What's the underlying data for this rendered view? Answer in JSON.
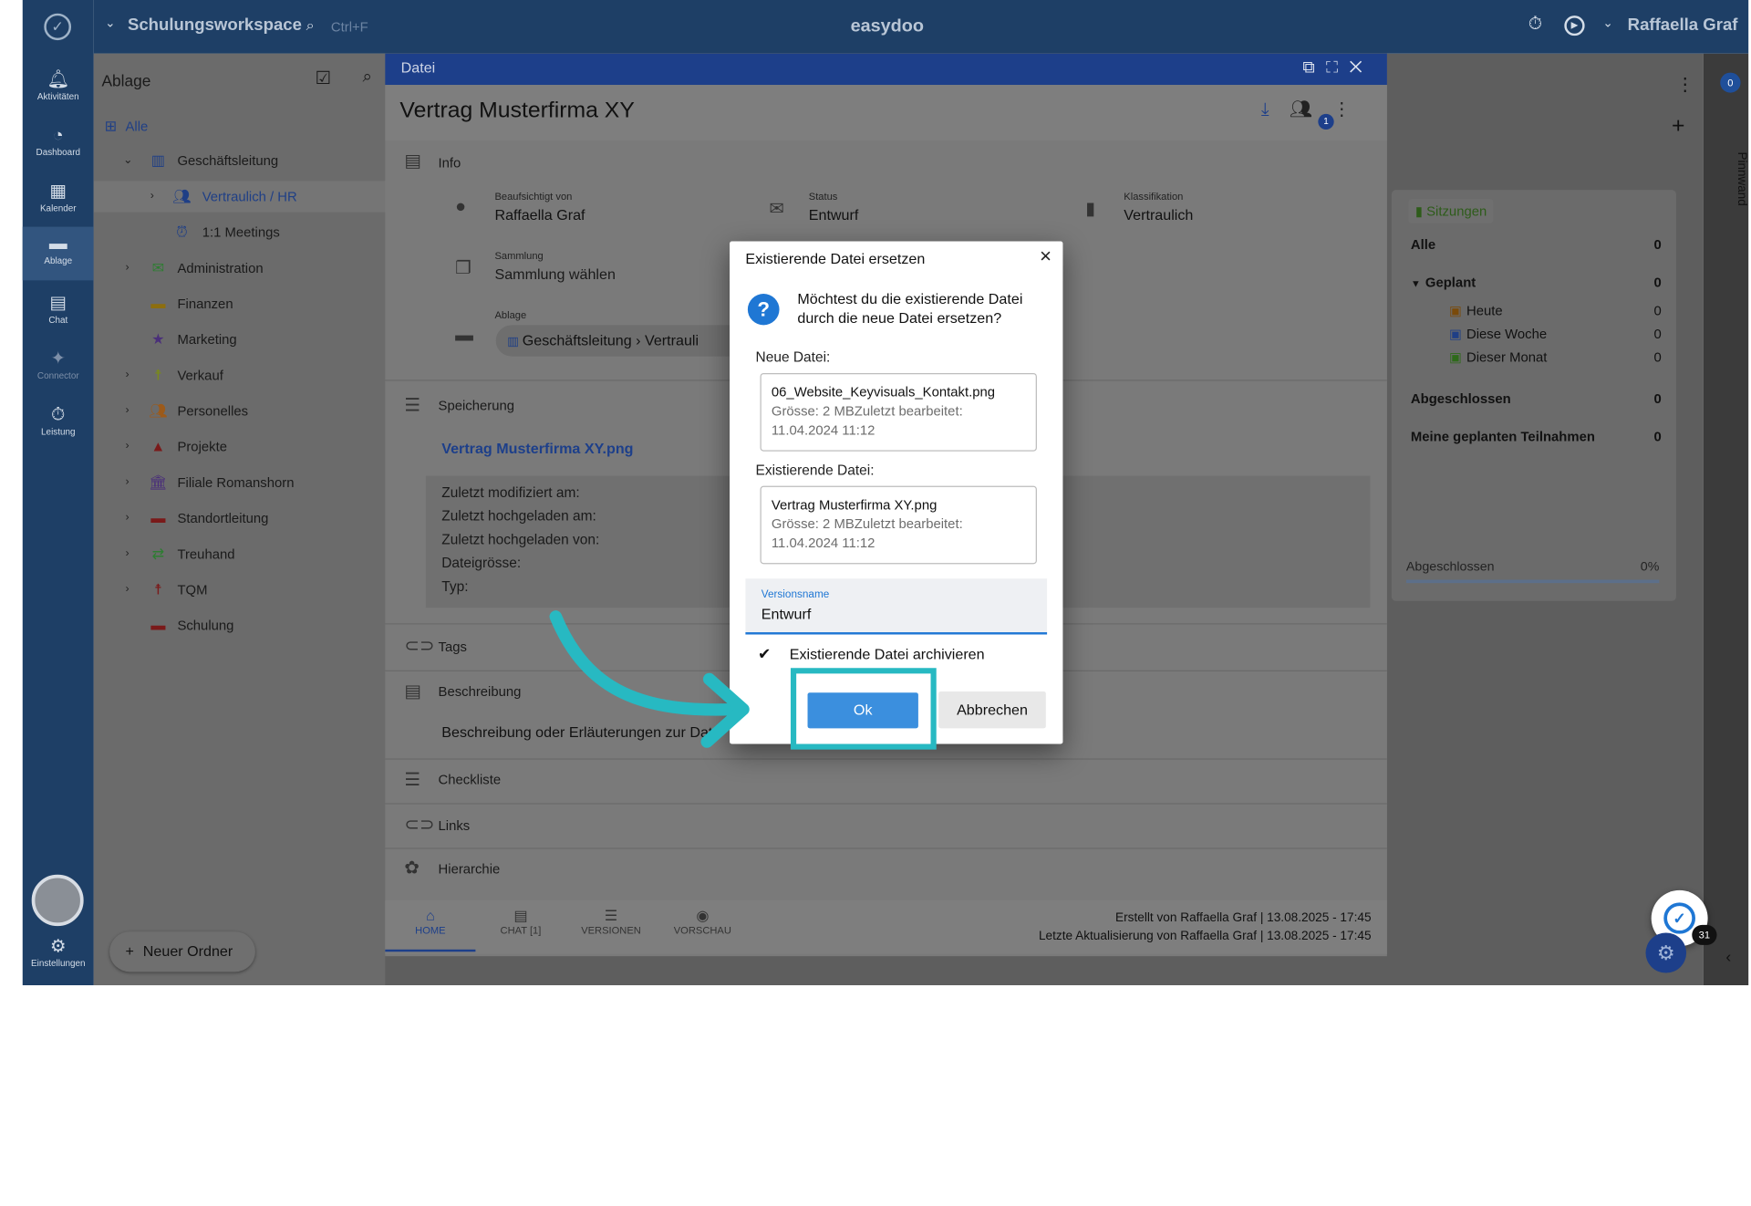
{
  "app": {
    "workspace": "Schulungsworkspace",
    "search_shortcut": "Ctrl+F",
    "title": "easydoo",
    "user_name": "Raffaella Graf"
  },
  "sidebar": {
    "items": [
      {
        "label": "Aktivitäten",
        "icon": "bell-icon"
      },
      {
        "label": "Dashboard",
        "icon": "gauge-icon"
      },
      {
        "label": "Kalender",
        "icon": "calendar-icon"
      },
      {
        "label": "Ablage",
        "icon": "folder-icon"
      },
      {
        "label": "Chat",
        "icon": "chat-icon"
      },
      {
        "label": "Connector",
        "icon": "connector-icon"
      },
      {
        "label": "Leistung",
        "icon": "stopwatch-icon"
      }
    ],
    "settings_label": "Einstellungen"
  },
  "left_panel": {
    "title": "Ablage",
    "all_label": "Alle",
    "tree": [
      {
        "label": "Geschäftsleitung"
      },
      {
        "label": "Vertraulich / HR"
      },
      {
        "label": "1:1 Meetings"
      },
      {
        "label": "Administration"
      },
      {
        "label": "Finanzen"
      },
      {
        "label": "Marketing"
      },
      {
        "label": "Verkauf"
      },
      {
        "label": "Personelles"
      },
      {
        "label": "Projekte"
      },
      {
        "label": "Filiale Romanshorn"
      },
      {
        "label": "Standortleitung"
      },
      {
        "label": "Treuhand"
      },
      {
        "label": "TQM"
      },
      {
        "label": "Schulung"
      }
    ],
    "new_folder_label": "Neuer Ordner"
  },
  "file_dialog": {
    "header": "Datei",
    "title": "Vertrag Musterfirma XY",
    "participant_badge": "1",
    "info_section": "Info",
    "overseen_by_label": "Beaufsichtigt von",
    "overseen_by_value": "Raffaella Graf",
    "status_label": "Status",
    "status_value": "Entwurf",
    "classification_label": "Klassifikation",
    "classification_value": "Vertraulich",
    "collection_label": "Sammlung",
    "collection_value": "Sammlung wählen",
    "storage_label": "Ablage",
    "storage_path": "Geschäftsleitung › Vertrauli",
    "storage_section": "Speicherung",
    "file_link": "Vertrag Musterfirma XY.png",
    "meta_rows": [
      "Zuletzt modifiziert am:",
      "Zuletzt hochgeladen am:",
      "Zuletzt hochgeladen von:",
      "Dateigrösse:",
      "Typ:"
    ],
    "tags_section": "Tags",
    "description_section": "Beschreibung",
    "description_placeholder": "Beschreibung oder Erläuterungen zur Dat",
    "checklist_section": "Checkliste",
    "links_section": "Links",
    "hierarchy_section": "Hierarchie",
    "footer_tabs": [
      "HOME",
      "CHAT [1]",
      "VERSIONEN",
      "VORSCHAU"
    ],
    "created_info": "Erstellt von Raffaella Graf | 13.08.2025 - 17:45",
    "updated_info": "Letzte Aktualisierung von Raffaella Graf | 13.08.2025 - 17:45"
  },
  "right_card": {
    "title": "Sitzungen",
    "rows": [
      {
        "label": "Alle",
        "count": "0"
      },
      {
        "label": "Geplant",
        "count": "0"
      },
      {
        "label": "Heute",
        "count": "0"
      },
      {
        "label": "Diese Woche",
        "count": "0"
      },
      {
        "label": "Dieser Monat",
        "count": "0"
      },
      {
        "label": "Abgeschlossen",
        "count": "0"
      },
      {
        "label": "Meine geplanten Teilnahmen",
        "count": "0"
      }
    ],
    "progress_label": "Abgeschlossen",
    "progress_value": "0%",
    "rail_label": "Pinnwand",
    "rail_badge": "0"
  },
  "modal": {
    "title": "Existierende Datei ersetzen",
    "question": "Möchtest du die existierende Datei durch die neue Datei ersetzen?",
    "new_file_label": "Neue Datei:",
    "new_file_name": "06_Website_Keyvisuals_Kontakt.png",
    "new_file_meta": "Grösse: 2 MBZuletzt bearbeitet: 11.04.2024 11:12",
    "existing_file_label": "Existierende Datei:",
    "existing_file_name": "Vertrag Musterfirma XY.png",
    "existing_file_meta": "Grösse: 2 MBZuletzt bearbeitet: 11.04.2024 11:12",
    "version_label": "Versionsname",
    "version_value": "Entwurf",
    "archive_label": "Existierende Datei archivieren",
    "ok_label": "Ok",
    "cancel_label": "Abbrechen"
  },
  "fab_badge": "31",
  "colors": {
    "accent": "#1f77d4",
    "header": "#1d3f8a",
    "sidebar": "#1e3f66",
    "highlight": "#27b9c2"
  }
}
